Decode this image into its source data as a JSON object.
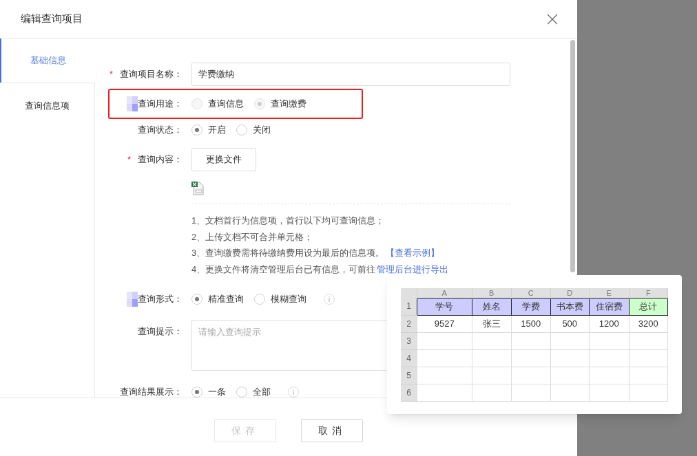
{
  "dialog": {
    "title": "编辑查询项目"
  },
  "tabs": [
    {
      "label": "基础信息",
      "selected": true
    },
    {
      "label": "查询信息项",
      "selected": false
    }
  ],
  "form": [
    {
      "kind": "text",
      "label": "查询项目名称：",
      "required_mark": "*",
      "value": "学费缴纳"
    },
    {
      "kind": "radio",
      "label": "查询用途：",
      "badge": true,
      "highlighted": true,
      "disabled": true,
      "options": [
        {
          "label": "查询信息",
          "selected": false
        },
        {
          "label": "查询缴费",
          "selected": true
        }
      ]
    },
    {
      "kind": "radio",
      "label": "查询状态：",
      "options": [
        {
          "label": "开启",
          "selected": true
        },
        {
          "label": "关闭",
          "selected": false
        }
      ]
    },
    {
      "kind": "file",
      "label": "查询内容：",
      "required_mark": "*",
      "button": "更换文件",
      "notes": [
        {
          "text": "1、文档首行为信息项，首行以下均可查询信息；"
        },
        {
          "text": "2、上传文档不可合并单元格；"
        },
        {
          "text": "3、查询缴费需将待缴纳费用设为最后的信息项。",
          "link": "【查看示例】"
        },
        {
          "text": "4、更换文件将清空管理后台已有信息，可前往",
          "link": "管理后台进行导出"
        }
      ]
    },
    {
      "kind": "radio",
      "label": "查询形式：",
      "badge": true,
      "info": true,
      "options": [
        {
          "label": "精准查询",
          "selected": true
        },
        {
          "label": "模糊查询",
          "selected": false
        }
      ]
    },
    {
      "kind": "textarea",
      "label": "查询提示：",
      "placeholder": "请输入查询提示"
    },
    {
      "kind": "radio",
      "label": "查询结果展示：",
      "info": true,
      "options": [
        {
          "label": "一条",
          "selected": true
        },
        {
          "label": "全部",
          "selected": false
        }
      ]
    }
  ],
  "buttons": [
    {
      "label": "保存",
      "disabled": true
    },
    {
      "label": "取消",
      "disabled": false
    }
  ],
  "example": {
    "columns": [
      "A",
      "B",
      "C",
      "D",
      "E",
      "F"
    ],
    "rows": [
      {
        "number": "1",
        "cells": [
          {
            "text": "学号",
            "color": "#ccccff"
          },
          {
            "text": "姓名",
            "color": "#ccccff"
          },
          {
            "text": "学费",
            "color": "#ccccff"
          },
          {
            "text": "书本费",
            "color": "#ccccff"
          },
          {
            "text": "住宿费",
            "color": "#ccccff"
          },
          {
            "text": "总计",
            "color": "#ccffcc"
          }
        ]
      },
      {
        "number": "2",
        "cells": [
          {
            "text": "9527"
          },
          {
            "text": "张三"
          },
          {
            "text": "1500"
          },
          {
            "text": "500"
          },
          {
            "text": "1200"
          },
          {
            "text": "3200"
          }
        ]
      },
      {
        "number": "3",
        "cells": []
      },
      {
        "number": "4",
        "cells": []
      },
      {
        "number": "5",
        "cells": []
      },
      {
        "number": "6",
        "cells": []
      }
    ]
  }
}
